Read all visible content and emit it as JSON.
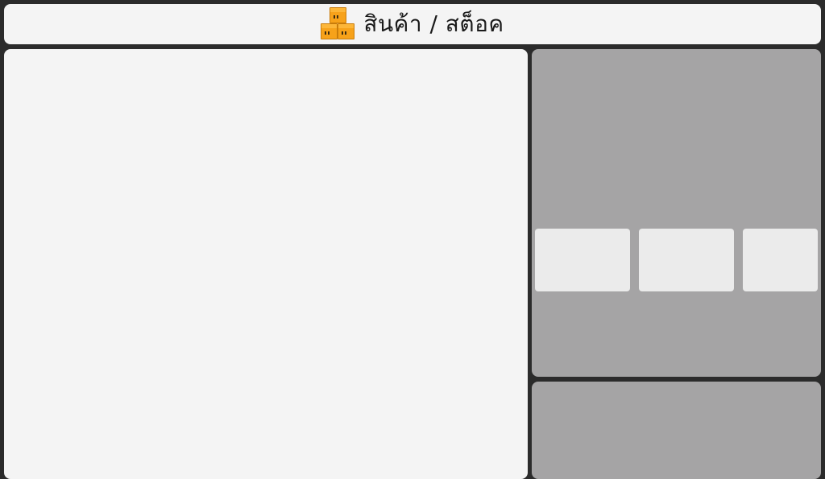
{
  "header": {
    "icon": "stacked-boxes-icon",
    "title": "สินค้า / สต็อค"
  },
  "colors": {
    "background": "#2b2b2b",
    "panel_light": "#f4f4f4",
    "panel_gray": "#a5a4a5",
    "card": "#ebebeb",
    "icon_orange": "#f7a21a"
  }
}
